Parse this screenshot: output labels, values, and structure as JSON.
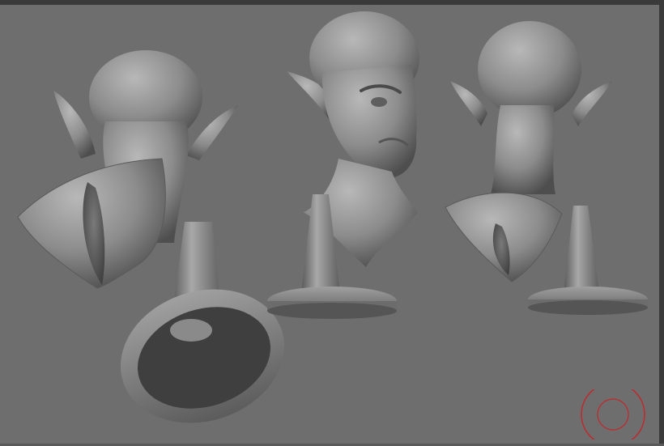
{
  "app": {
    "background_color": "#6e6e6e",
    "frame_color": "#3a3a3a",
    "mesh_color": "#8a8a8a"
  },
  "brush_cursor": {
    "color": "#c0282b",
    "icon": "brush-cursor-icon"
  },
  "objects": [
    {
      "name": "head-back-tilted-view"
    },
    {
      "name": "head-front-three-quarter-view"
    },
    {
      "name": "head-back-view"
    },
    {
      "name": "stand-underside-view"
    },
    {
      "name": "stand-side-view"
    },
    {
      "name": "stand-side-view-right"
    }
  ]
}
